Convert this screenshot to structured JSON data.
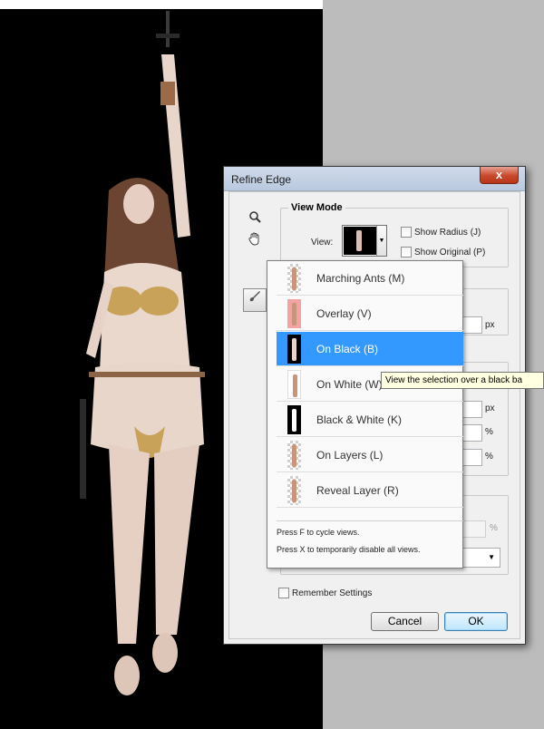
{
  "dialog": {
    "title": "Refine Edge",
    "close_label": "x",
    "view_mode": {
      "group_title": "View Mode",
      "view_label": "View:",
      "show_radius": "Show Radius (J)",
      "show_original": "Show Original (P)"
    },
    "units": {
      "px1": "px",
      "px2": "px",
      "pct1": "%",
      "pct2": "%",
      "pct3": "%"
    },
    "output_select_arrow": "▼",
    "remember_settings": "Remember Settings",
    "cancel": "Cancel",
    "ok": "OK"
  },
  "view_menu": {
    "items": [
      {
        "label": "Marching Ants (M)",
        "thumb": "checker"
      },
      {
        "label": "Overlay (V)",
        "thumb": "overlay"
      },
      {
        "label": "On Black (B)",
        "thumb": "black",
        "selected": true
      },
      {
        "label": "On White (W)",
        "thumb": "white"
      },
      {
        "label": "Black & White (K)",
        "thumb": "bw"
      },
      {
        "label": "On Layers (L)",
        "thumb": "checker"
      },
      {
        "label": "Reveal Layer (R)",
        "thumb": "checker"
      }
    ],
    "hint_cycle": "Press F to cycle views.",
    "hint_disable": "Press X to temporarily disable all views."
  },
  "tooltip": "View the selection over a black ba",
  "colors": {
    "selection_blue": "#3399ff",
    "tooltip_bg": "#ffffe1",
    "close_red": "#c9472b"
  },
  "icons": {
    "zoom": "zoom-icon",
    "hand": "hand-icon",
    "brush": "refine-radius-brush-icon"
  }
}
